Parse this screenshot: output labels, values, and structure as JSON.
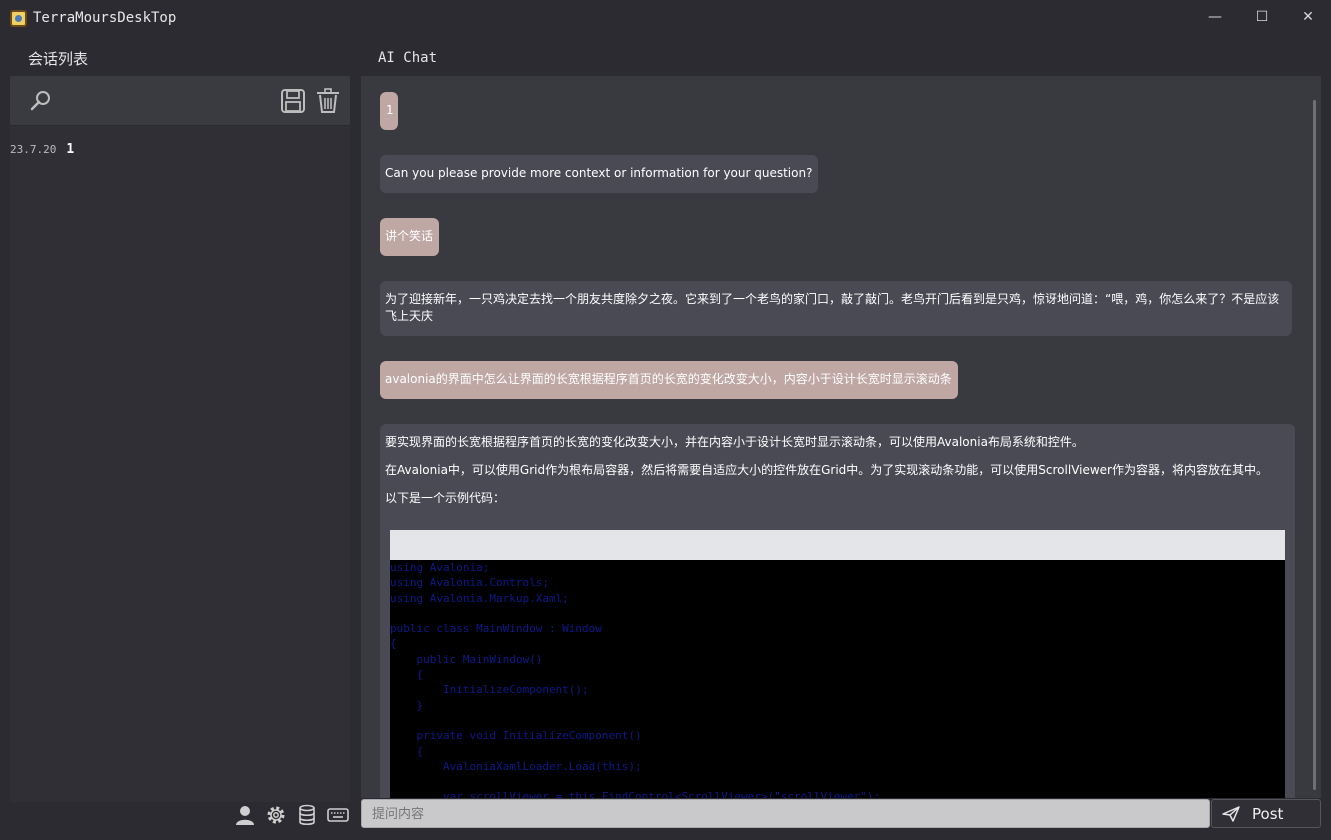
{
  "window": {
    "title": "TerraMoursDeskTop",
    "controls": {
      "minimize": "—",
      "maximize": "☐",
      "close": "✕"
    }
  },
  "sidebar": {
    "title": "会话列表",
    "toolbar": {
      "search_icon": "search-icon",
      "save_icon": "save-icon",
      "delete_icon": "trash-icon"
    },
    "sessions": [
      {
        "date": "23.7.20",
        "name": "1"
      }
    ]
  },
  "bottom_bar": {
    "icons": [
      "user-icon",
      "gear-icon",
      "database-icon",
      "keyboard-icon"
    ]
  },
  "chat": {
    "title": "AI Chat",
    "messages": [
      {
        "role": "user",
        "text": "1"
      },
      {
        "role": "assistant",
        "text": "Can you please provide more context or information for your question?"
      },
      {
        "role": "user",
        "text": "讲个笑话"
      },
      {
        "role": "assistant",
        "text": "为了迎接新年，一只鸡决定去找一个朋友共度除夕之夜。它来到了一个老鸟的家门口，敲了敲门。老鸟开门后看到是只鸡，惊讶地问道：“喂，鸡，你怎么来了？不是应该飞上天庆"
      },
      {
        "role": "user",
        "text": "avalonia的界面中怎么让界面的长宽根据程序首页的长宽的变化改变大小，内容小于设计长宽时显示滚动条"
      },
      {
        "role": "assistant",
        "paragraphs": [
          "要实现界面的长宽根据程序首页的长宽的变化改变大小，并在内容小于设计长宽时显示滚动条，可以使用Avalonia布局系统和控件。",
          "在Avalonia中，可以使用Grid作为根布局容器，然后将需要自适应大小的控件放在Grid中。为了实现滚动条功能，可以使用ScrollViewer作为容器，将内容放在其中。",
          "以下是一个示例代码："
        ],
        "code": [
          "using Avalonia;",
          "using Avalonia.Controls;",
          "using Avalonia.Markup.Xaml;",
          "",
          "public class MainWindow : Window",
          "{",
          "    public MainWindow()",
          "    {",
          "        InitializeComponent();",
          "    }",
          "",
          "    private void InitializeComponent()",
          "    {",
          "        AvaloniaXamlLoader.Load(this);",
          "",
          "        var scrollViewer = this.FindControl<ScrollViewer>(\"scrollViewer\");"
        ]
      }
    ]
  },
  "input": {
    "placeholder": "提问内容",
    "send_label": "Post"
  }
}
